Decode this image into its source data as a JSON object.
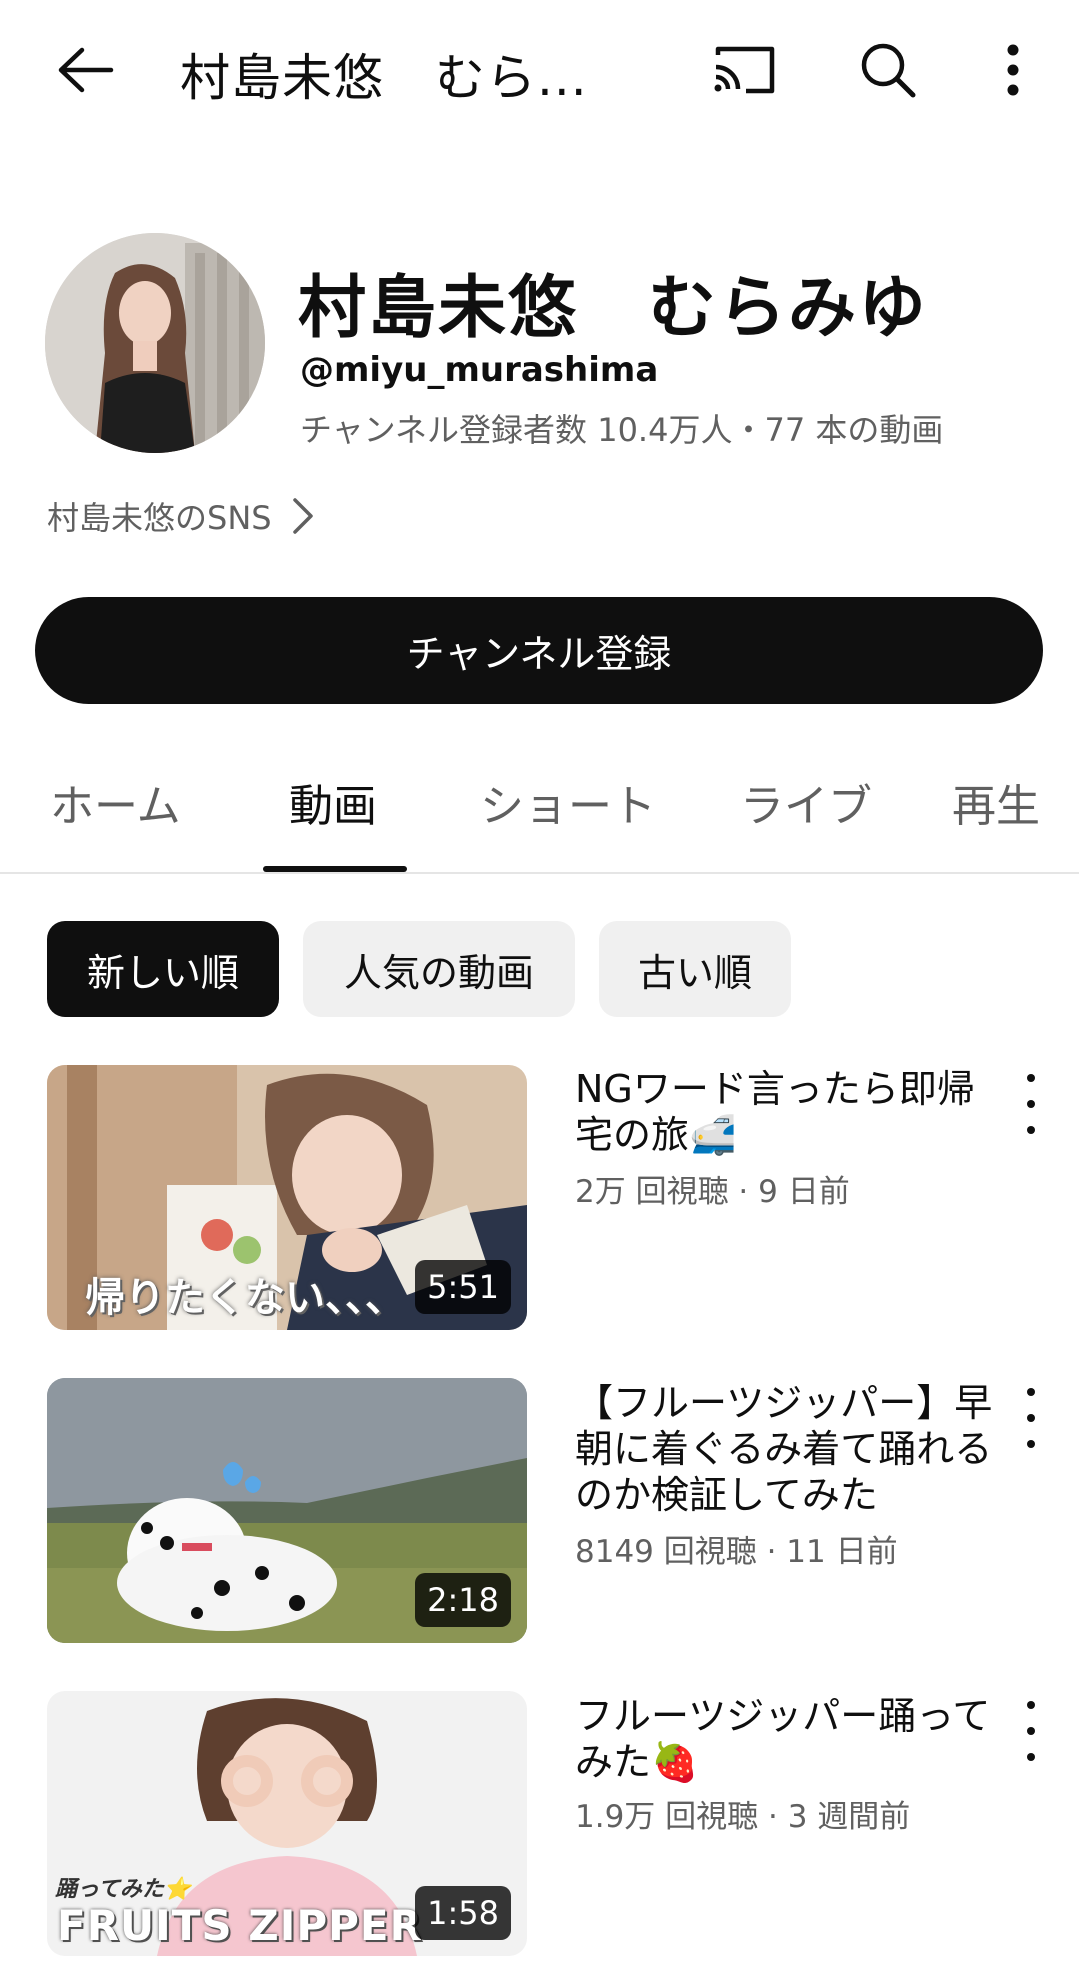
{
  "topbar": {
    "title": "村島未悠　むら...",
    "back_icon": "arrow-left-icon",
    "cast_icon": "cast-icon",
    "search_icon": "search-icon",
    "more_icon": "more-vert-icon"
  },
  "channel": {
    "name": "村島未悠　むらみゆ",
    "handle": "@miyu_murashima",
    "stats": "チャンネル登録者数 10.4万人・77 本の動画",
    "sns_link": "村島未悠のSNS",
    "subscribe_label": "チャンネル登録"
  },
  "tabs": [
    {
      "label": "ホーム",
      "active": false
    },
    {
      "label": "動画",
      "active": true
    },
    {
      "label": "ショート",
      "active": false
    },
    {
      "label": "ライブ",
      "active": false
    },
    {
      "label": "再生",
      "active": false
    }
  ],
  "chips": [
    {
      "label": "新しい順",
      "active": true
    },
    {
      "label": "人気の動画",
      "active": false
    },
    {
      "label": "古い順",
      "active": false
    }
  ],
  "videos": [
    {
      "title": "NGワード言ったら即帰宅の旅🚅",
      "meta": "2万 回視聴 · 9 日前",
      "duration": "5:51",
      "thumb_text": "帰りたくない、、、"
    },
    {
      "title": "【フルーツジッパー】早朝に着ぐるみ着て踊れるのか検証してみた",
      "meta": "8149 回視聴 · 11 日前",
      "duration": "2:18",
      "thumb_text": ""
    },
    {
      "title": "フルーツジッパー踊ってみた🍓",
      "meta": "1.9万 回視聴 · 3 週間前",
      "duration": "1:58",
      "thumb_text": "FRUITS ZIPPER",
      "thumb_text_small": "踊ってみた⭐"
    }
  ]
}
